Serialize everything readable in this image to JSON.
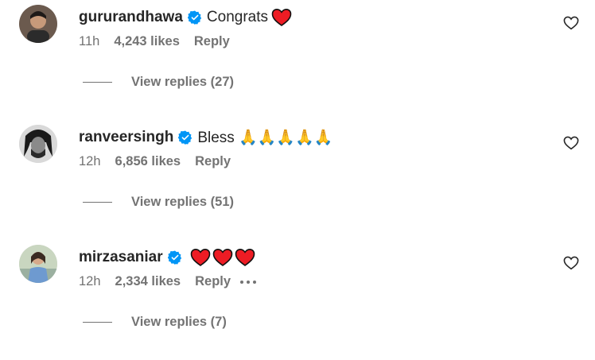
{
  "comments": [
    {
      "username": "gururandhawa",
      "text": "Congrats",
      "hearts": 1,
      "time": "11h",
      "likes": "4,243 likes",
      "reply": "Reply",
      "view_replies": "View replies (27)",
      "avatar_color": "#5b4a3f"
    },
    {
      "username": "ranveersingh",
      "text": "Bless 🙏🙏🙏🙏🙏",
      "hearts": 0,
      "time": "12h",
      "likes": "6,856 likes",
      "reply": "Reply",
      "view_replies": "View replies (51)",
      "avatar_color": "#3a3a3a"
    },
    {
      "username": "mirzasaniar",
      "text": "",
      "hearts": 3,
      "time": "12h",
      "likes": "2,334 likes",
      "reply": "Reply",
      "view_replies": "View replies (7)",
      "avatar_color": "#7fa3c8"
    }
  ],
  "colors": {
    "verified": "#0095f6",
    "heart": "#ed1c24",
    "secondary_text": "#737373",
    "primary_text": "#262626"
  }
}
